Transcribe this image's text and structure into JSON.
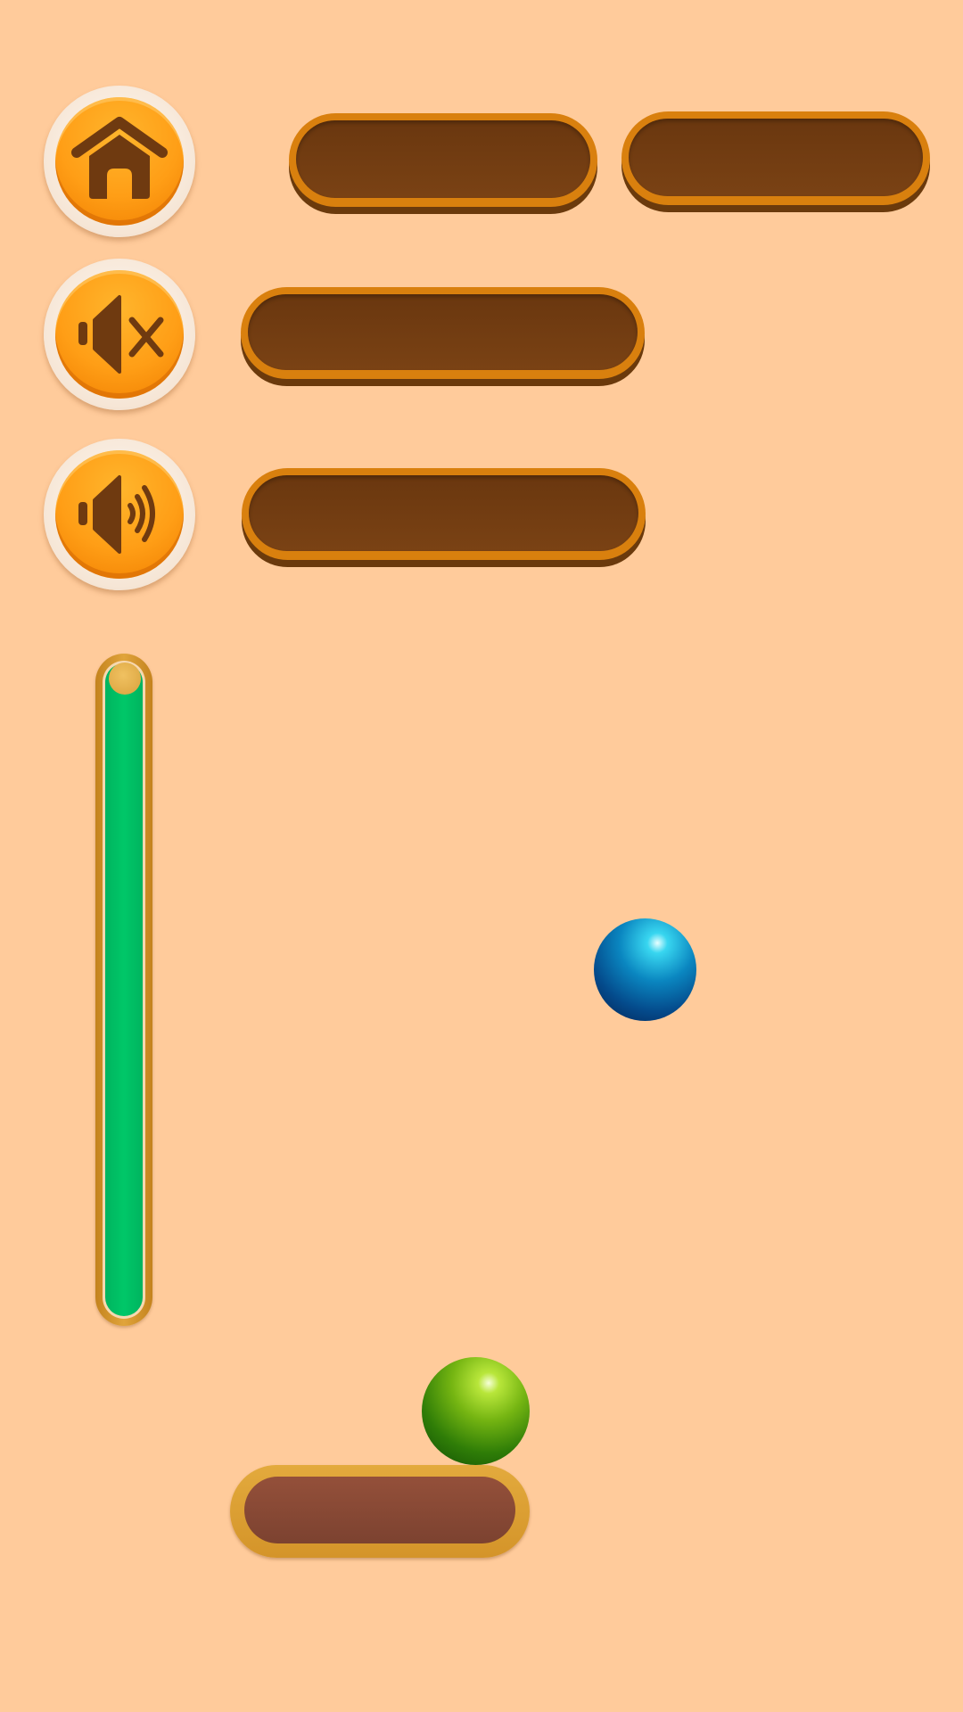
{
  "menu": {
    "buttons": [
      {
        "icon": "home-icon",
        "label": ""
      },
      {
        "icon": "mute-icon",
        "label": ""
      },
      {
        "icon": "volume-icon",
        "label": ""
      }
    ]
  },
  "hud": {
    "top_left_bar": "",
    "top_right_bar": "",
    "sound_off_bar": "",
    "sound_on_bar": ""
  },
  "gauge": {
    "level": 1.0,
    "fill_color": "#00c768"
  },
  "game": {
    "balls": [
      {
        "color": "blue",
        "hex": "#0a86c0"
      },
      {
        "color": "green",
        "hex": "#75b512"
      }
    ],
    "paddle_label": ""
  },
  "colors": {
    "background": "#ffcb9b",
    "button_orange": "#ff9e16",
    "bar_brown": "#7a4214",
    "bar_rim": "#d9800e"
  }
}
